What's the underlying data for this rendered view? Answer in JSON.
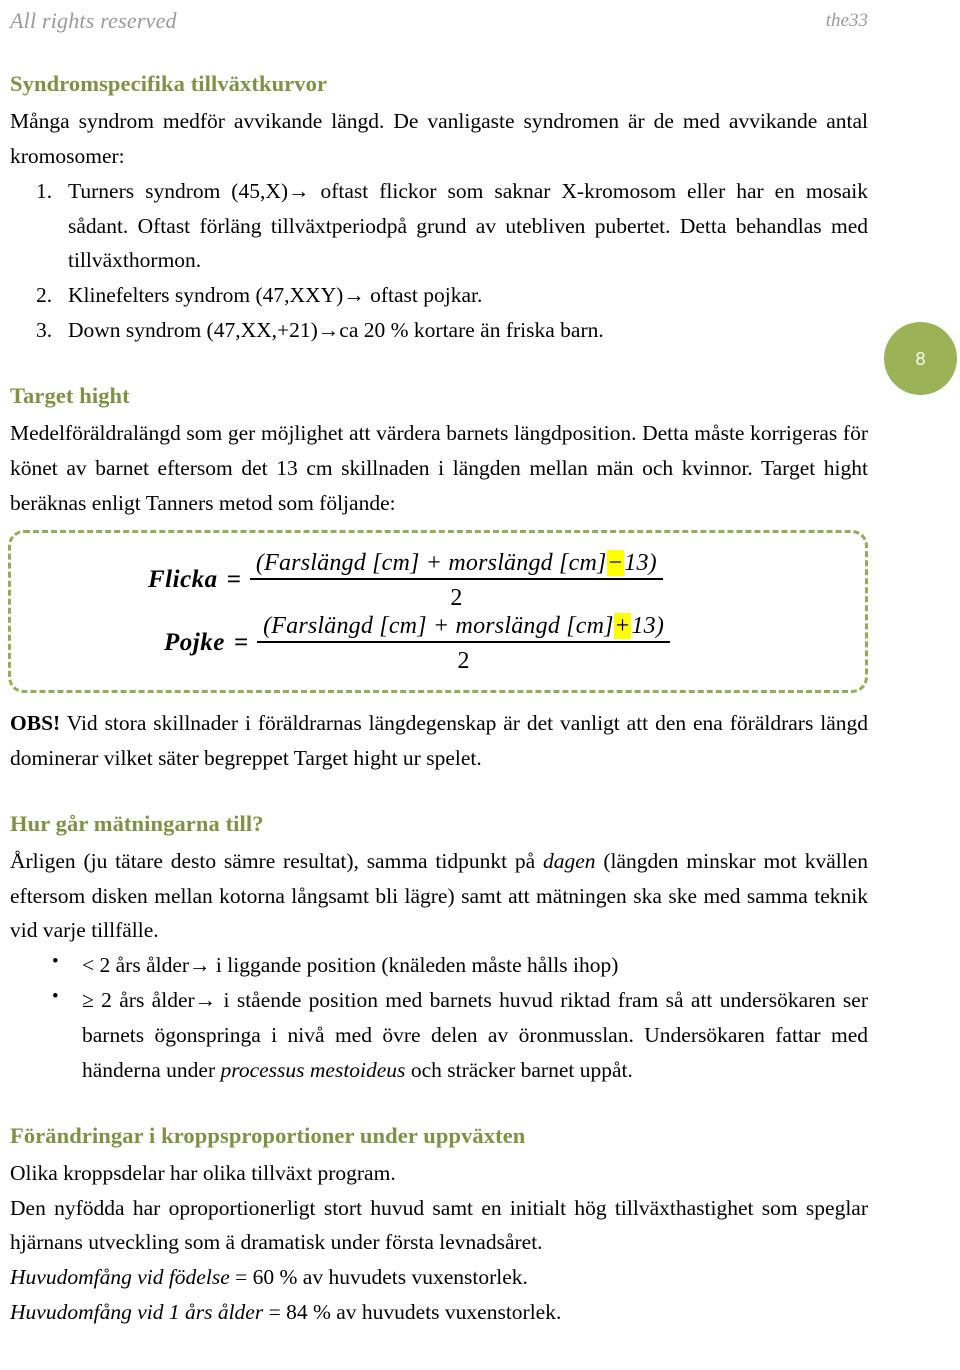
{
  "header": {
    "left": "All rights reserved",
    "right": "the33"
  },
  "page_badge": {
    "number": "8",
    "color": "#9bb356"
  },
  "colors": {
    "heading_green": "#7f9142",
    "dashed_border_green": "#8fae55",
    "highlight_yellow": "#ffff00",
    "header_gray": "#9a9a9a"
  },
  "sections": {
    "syndrome": {
      "title": "Syndromspecifika tillväxtkurvor",
      "intro": "Många syndrom medför avvikande längd. De vanligaste syndromen är de med avvikande antal kromosomer:",
      "items": [
        "Turners syndrom (45,X)→ oftast flickor som saknar X-kromosom eller har en mosaik sådant. Oftast förläng tillväxtperiodpå grund av utebliven pubertet. Detta behandlas med tillväxthormon.",
        "Klinefelters syndrom (47,XXY)→ oftast pojkar.",
        "Down syndrom (47,XX,+21)→ca 20 % kortare än friska barn."
      ]
    },
    "target_hight": {
      "title": "Target hight",
      "paragraph": "Medelföräldralängd som ger möjlighet att värdera barnets längdposition. Detta måste korrigeras för könet av barnet eftersom det 13 cm skillnaden i längden mellan män och kvinnor. Target hight beräknas enligt Tanners metod som följande:",
      "formula": {
        "girl": {
          "label": "Flicka",
          "equals": "=",
          "numerator_pre": "(Farslängd [cm] + morslängd [cm]",
          "numerator_sign": "−",
          "numerator_post": "13)",
          "denominator": "2"
        },
        "boy": {
          "label": "Pojke",
          "equals": "=",
          "numerator_pre": "(Farslängd [cm] + morslängd [cm]",
          "numerator_sign": "+",
          "numerator_post": "13)",
          "denominator": "2"
        }
      },
      "note_bold": "OBS!",
      "note_rest": " Vid stora skillnader i föräldrarnas längdegenskap är det vanligt att den ena föräldrars längd dominerar vilket säter begreppet Target hight ur spelet."
    },
    "measurement": {
      "title": "Hur går mätningarna till?",
      "paragraph_pre": "Årligen (ju tätare desto sämre resultat), samma tidpunkt på ",
      "paragraph_italic": "dagen",
      "paragraph_post": " (längden minskar mot kvällen eftersom disken mellan kotorna långsamt bli lägre) samt att mätningen ska ske med samma teknik vid varje tillfälle.",
      "bullets": [
        "< 2 års ålder→ i liggande position (knäleden måste hålls ihop)",
        "≥ 2 års ålder→ i stående position med barnets huvud riktad fram så att undersökaren ser barnets ögonspringa i nivå med övre delen av öronmusslan. Undersökaren fattar med händerna under "
      ],
      "bullet2_italic": "processus mestoideus",
      "bullet2_post": " och sträcker barnet uppåt."
    },
    "proportions": {
      "title": "Förändringar i kroppsproportioner under uppväxten",
      "line1": "Olika kroppsdelar har olika tillväxt program.",
      "line2": "Den nyfödda har oproportionerligt stort huvud samt en initialt hög tillväxthastighet som speglar hjärnans utveckling som ä dramatisk under första levnadsåret.",
      "fact1_italic": "Huvudomfång vid födelse",
      "fact1_rest": " = 60 % av huvudets vuxenstorlek.",
      "fact2_italic": "Huvudomfång vid 1 års ålder",
      "fact2_rest": " = 84 % av huvudets vuxenstorlek."
    }
  }
}
